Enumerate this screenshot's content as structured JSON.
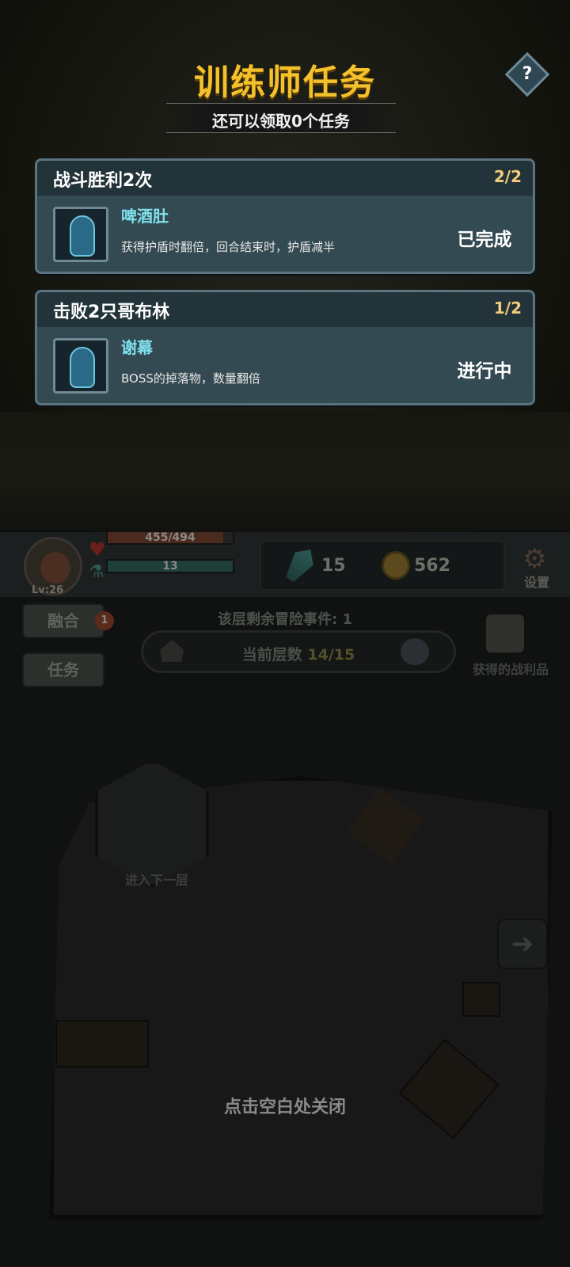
{
  "popup": {
    "title": "训练师任务",
    "subtitle": "还可以领取0个任务",
    "help_label": "?",
    "close_hint": "点击空白处关闭"
  },
  "missions": [
    {
      "name": "战斗胜利2次",
      "progress": "2/2",
      "skill_name": "啤酒肚",
      "skill_desc": "获得护盾时翻倍，回合结束时，护盾减半",
      "status": "已完成"
    },
    {
      "name": "击败2只哥布林",
      "progress": "1/2",
      "skill_name": "谢幕",
      "skill_desc": "BOSS的掉落物，数量翻倍",
      "status": "进行中"
    }
  ],
  "hud": {
    "level": "Lv:26",
    "hp": "455/494",
    "hp_fraction": 0.921,
    "mp": "13",
    "gems": "15",
    "coins": "562",
    "settings_label": "设置"
  },
  "side": {
    "fuse_label": "融合",
    "fuse_badge": "1",
    "task_label": "任务",
    "remaining_events": "该层剩余冒险事件: 1",
    "floor_label": "当前层数",
    "floor_value": "14/15",
    "loot_label": "获得的战利品"
  },
  "room": {
    "stairs_label": "进入下一层",
    "next_arrow": "➔"
  },
  "colors": {
    "title": "#f4c12a",
    "card_bg": "#344a52",
    "skill_name": "#7fe0ec",
    "progress": "#f4cd7a"
  },
  "icons": {
    "help": "help-icon",
    "heart": "heart-icon",
    "potion": "potion-icon",
    "gem": "gem-icon",
    "coin": "coin-icon",
    "gear": "gear-icon",
    "chest": "chest-icon"
  }
}
